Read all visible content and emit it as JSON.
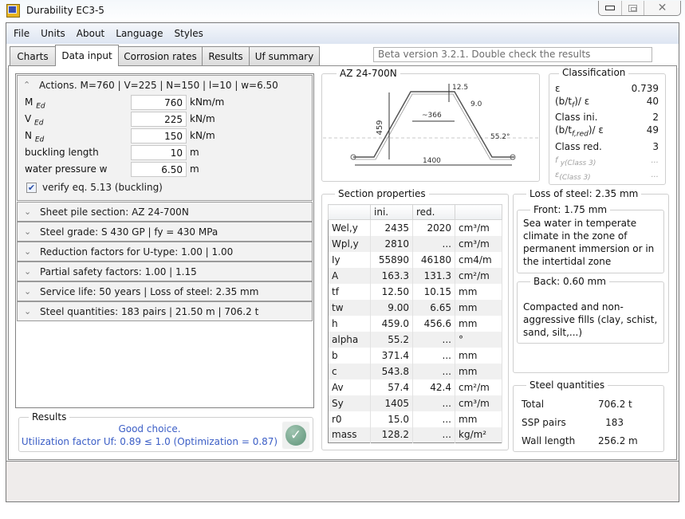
{
  "window": {
    "title": "Durability EC3-5",
    "controls": {
      "minimize": "minimize",
      "maximize": "maximize",
      "close": "close"
    }
  },
  "menu": [
    "File",
    "Units",
    "About",
    "Language",
    "Styles"
  ],
  "tabs": [
    {
      "label": "Charts",
      "active": false
    },
    {
      "label": "Data input",
      "active": true
    },
    {
      "label": "Corrosion rates",
      "active": false
    },
    {
      "label": "Results",
      "active": false
    },
    {
      "label": "Uf summary",
      "active": false
    }
  ],
  "beta_notice": "Beta version 3.2.1. Double check the results",
  "actions": {
    "header": "Actions. M=760 | V=225 | N=150 | l=10 | w=6.50",
    "fields": [
      {
        "label": "M",
        "sub": "Ed",
        "value": "760",
        "unit": "kNm/m"
      },
      {
        "label": "V",
        "sub": "Ed",
        "value": "225",
        "unit": "kN/m"
      },
      {
        "label": "N",
        "sub": "Ed",
        "value": "150",
        "unit": "kN/m"
      },
      {
        "label": "buckling length",
        "sub": "",
        "value": "10",
        "unit": "m"
      },
      {
        "label": "water pressure w",
        "sub": "",
        "value": "6.50",
        "unit": "m"
      }
    ],
    "verify_checkbox": {
      "label": "verify eq. 5.13 (buckling)",
      "checked": true
    }
  },
  "collapsed_sections": [
    "Sheet pile section:  AZ 24-700N",
    "Steel grade: S 430 GP | fy = 430 MPa",
    "Reduction factors for U-type: 1.00 | 1.00",
    "Partial safety factors: 1.00 | 1.15",
    "Service life:  50 years | Loss of steel: 2.35 mm",
    "Steel quantities: 183 pairs | 21.50 m | 706.2 t"
  ],
  "results": {
    "title": "Results",
    "line1": "Good choice.",
    "line2": "Utilization factor Uf: 0.89 ≤ 1.0 (Optimization =  0.87)",
    "status_icon": "check-icon"
  },
  "drawing": {
    "title": "AZ 24-700N",
    "dims": {
      "height": "459",
      "flange": "12.5",
      "web": "9.0",
      "width_top": "~366",
      "angle": "55.2°",
      "width": "1400"
    }
  },
  "classification": {
    "title": "Classification",
    "rows": [
      {
        "label": "ε",
        "sub": "",
        "value": "0.739",
        "muted": false
      },
      {
        "label": "(b/t",
        "sub": "f",
        "suffix": ")/ ε",
        "value": "40",
        "muted": false
      },
      {
        "label": "Class ini.",
        "sub": "",
        "value": "2",
        "muted": false
      },
      {
        "label": "(b/t",
        "sub": "f,red",
        "suffix": ")/ ε",
        "value": "49",
        "muted": false
      },
      {
        "label": "Class red.",
        "sub": "",
        "value": "3",
        "muted": false
      },
      {
        "label": "f",
        "sub": "y(Class 3)",
        "value": "...",
        "muted": true
      },
      {
        "label": "ε",
        "sub": "(Class 3)",
        "value": "...",
        "muted": true
      }
    ]
  },
  "section_properties": {
    "title": "Section properties",
    "columns": [
      "",
      "ini.",
      "red.",
      ""
    ],
    "rows": [
      {
        "name": "Wel,y",
        "ini": "2435",
        "red": "2020",
        "unit": "cm³/m"
      },
      {
        "name": "Wpl,y",
        "ini": "2810",
        "red": "...",
        "unit": "cm³/m"
      },
      {
        "name": "Iy",
        "ini": "55890",
        "red": "46180",
        "unit": "cm4/m"
      },
      {
        "name": "A",
        "ini": "163.3",
        "red": "131.3",
        "unit": "cm²/m"
      },
      {
        "name": "tf",
        "ini": "12.50",
        "red": "10.15",
        "unit": "mm"
      },
      {
        "name": "tw",
        "ini": "9.00",
        "red": "6.65",
        "unit": "mm"
      },
      {
        "name": "h",
        "ini": "459.0",
        "red": "456.6",
        "unit": "mm"
      },
      {
        "name": "alpha",
        "ini": "55.2",
        "red": "...",
        "unit": "°"
      },
      {
        "name": "b",
        "ini": "371.4",
        "red": "...",
        "unit": "mm"
      },
      {
        "name": "c",
        "ini": "543.8",
        "red": "...",
        "unit": "mm"
      },
      {
        "name": "Av",
        "ini": "57.4",
        "red": "42.4",
        "unit": "cm²/m"
      },
      {
        "name": "Sy",
        "ini": "1405",
        "red": "...",
        "unit": "cm³/m"
      },
      {
        "name": "r0",
        "ini": "15.0",
        "red": "...",
        "unit": "mm"
      },
      {
        "name": "mass",
        "ini": "128.2",
        "red": "...",
        "unit": "kg/m²"
      }
    ]
  },
  "loss_of_steel": {
    "title": "Loss of steel:   2.35 mm",
    "front": {
      "title": "Front:   1.75 mm",
      "text": "Sea water in temperate climate in the zone of permanent immersion or in the intertidal zone"
    },
    "back": {
      "title": "Back:   0.60 mm",
      "text": "Compacted and non-aggressive fills (clay, schist, sand, silt,...)"
    }
  },
  "steel_quantities": {
    "title": "Steel quantities",
    "rows": [
      {
        "label": "Total",
        "value": "706.2",
        "unit": "t"
      },
      {
        "label": "SSP pairs",
        "value": "183",
        "unit": ""
      },
      {
        "label": "Wall length",
        "value": "256.2",
        "unit": "m"
      }
    ]
  }
}
